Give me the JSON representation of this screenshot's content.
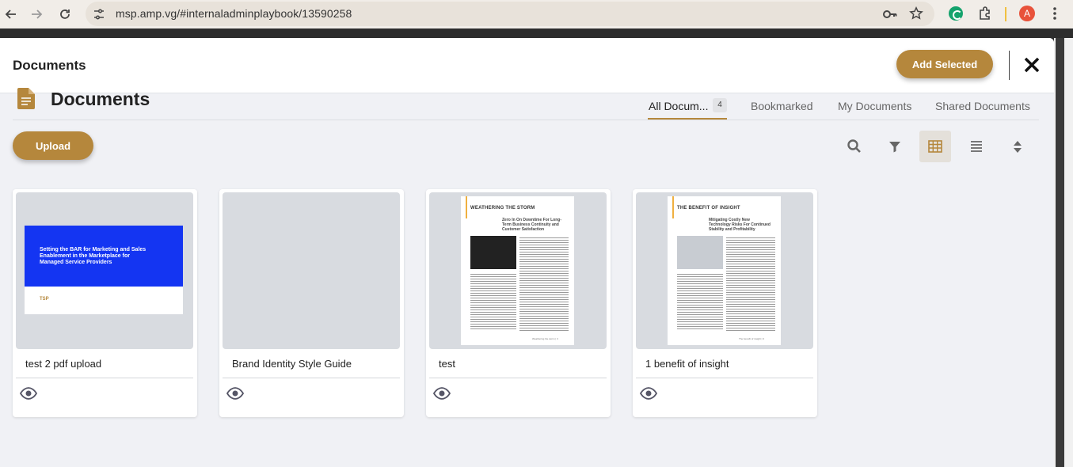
{
  "browser": {
    "url": "msp.amp.vg/#internaladminplaybook/13590258",
    "profile_initial": "A"
  },
  "modal": {
    "title": "Documents",
    "add_selected_label": "Add Selected"
  },
  "section": {
    "title": "Documents",
    "tabs": [
      {
        "label": "All Docum...",
        "count": "4",
        "active": true
      },
      {
        "label": "Bookmarked",
        "active": false
      },
      {
        "label": "My Documents",
        "active": false
      },
      {
        "label": "Shared Documents",
        "active": false
      }
    ],
    "upload_label": "Upload"
  },
  "toolbar": {
    "icons": [
      "search-icon",
      "filter-icon",
      "grid-view-icon",
      "list-view-icon",
      "sort-icon"
    ],
    "active_view": "grid"
  },
  "documents": [
    {
      "name": "test 2 pdf upload",
      "cover_text": "Setting the BAR for Marketing and Sales Enablement in the Marketplace for Managed Service Providers",
      "cover_logo": "TSP"
    },
    {
      "name": "Brand Identity Style Guide"
    },
    {
      "name": "test",
      "page_heading": "WEATHERING THE STORM",
      "page_subheading": "Zero In On Downtime For Long-Term Business Continuity and Customer Satisfaction",
      "page_footer": "Weathering the storm  |  3"
    },
    {
      "name": "1 benefit of insight",
      "page_heading": "THE BENEFIT OF INSIGHT",
      "page_subheading": "Mitigating Costly New Technology Risks For Continued Stability and Profitability",
      "page_footer": "The benefit of insight  |  3"
    }
  ],
  "colors": {
    "accent": "#b5873c",
    "cover_blue": "#1435f2",
    "background": "#f0f1f5"
  }
}
